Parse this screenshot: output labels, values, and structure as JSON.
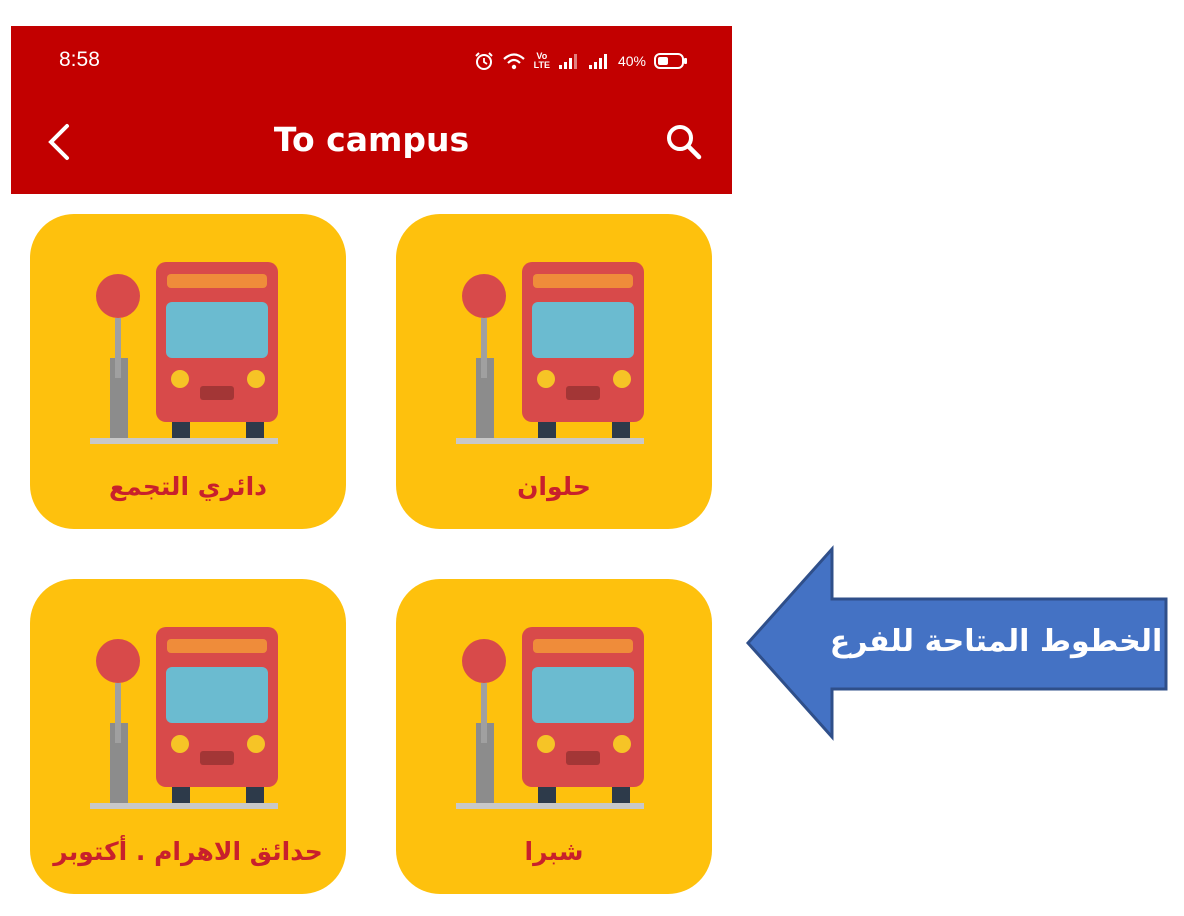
{
  "status_bar": {
    "time": "8:58",
    "battery": "40%",
    "icons": [
      "alarm-icon",
      "wifi-icon",
      "volte-icon",
      "signal-icon",
      "signal-icon",
      "battery-icon"
    ],
    "volte_top": "Vo",
    "volte_bottom": "LTE"
  },
  "header": {
    "title": "To campus",
    "back_icon": "chevron-left-icon",
    "search_icon": "search-icon",
    "color": "#c20000"
  },
  "routes": [
    {
      "label": "حلوان",
      "icon": "bus-stop-icon"
    },
    {
      "label": "دائري التجمع",
      "icon": "bus-stop-icon"
    },
    {
      "label": "شبرا",
      "icon": "bus-stop-icon"
    },
    {
      "label": "حدائق الاهرام . أكتوبر",
      "icon": "bus-stop-icon"
    }
  ],
  "annotation": {
    "text": "الخطوط المتاحة للفرع",
    "color": "#4472c4"
  },
  "colors": {
    "tile": "#fec10d",
    "label": "#c8202c",
    "bus_body": "#d84a4a",
    "bus_window": "#6bbbd0"
  }
}
